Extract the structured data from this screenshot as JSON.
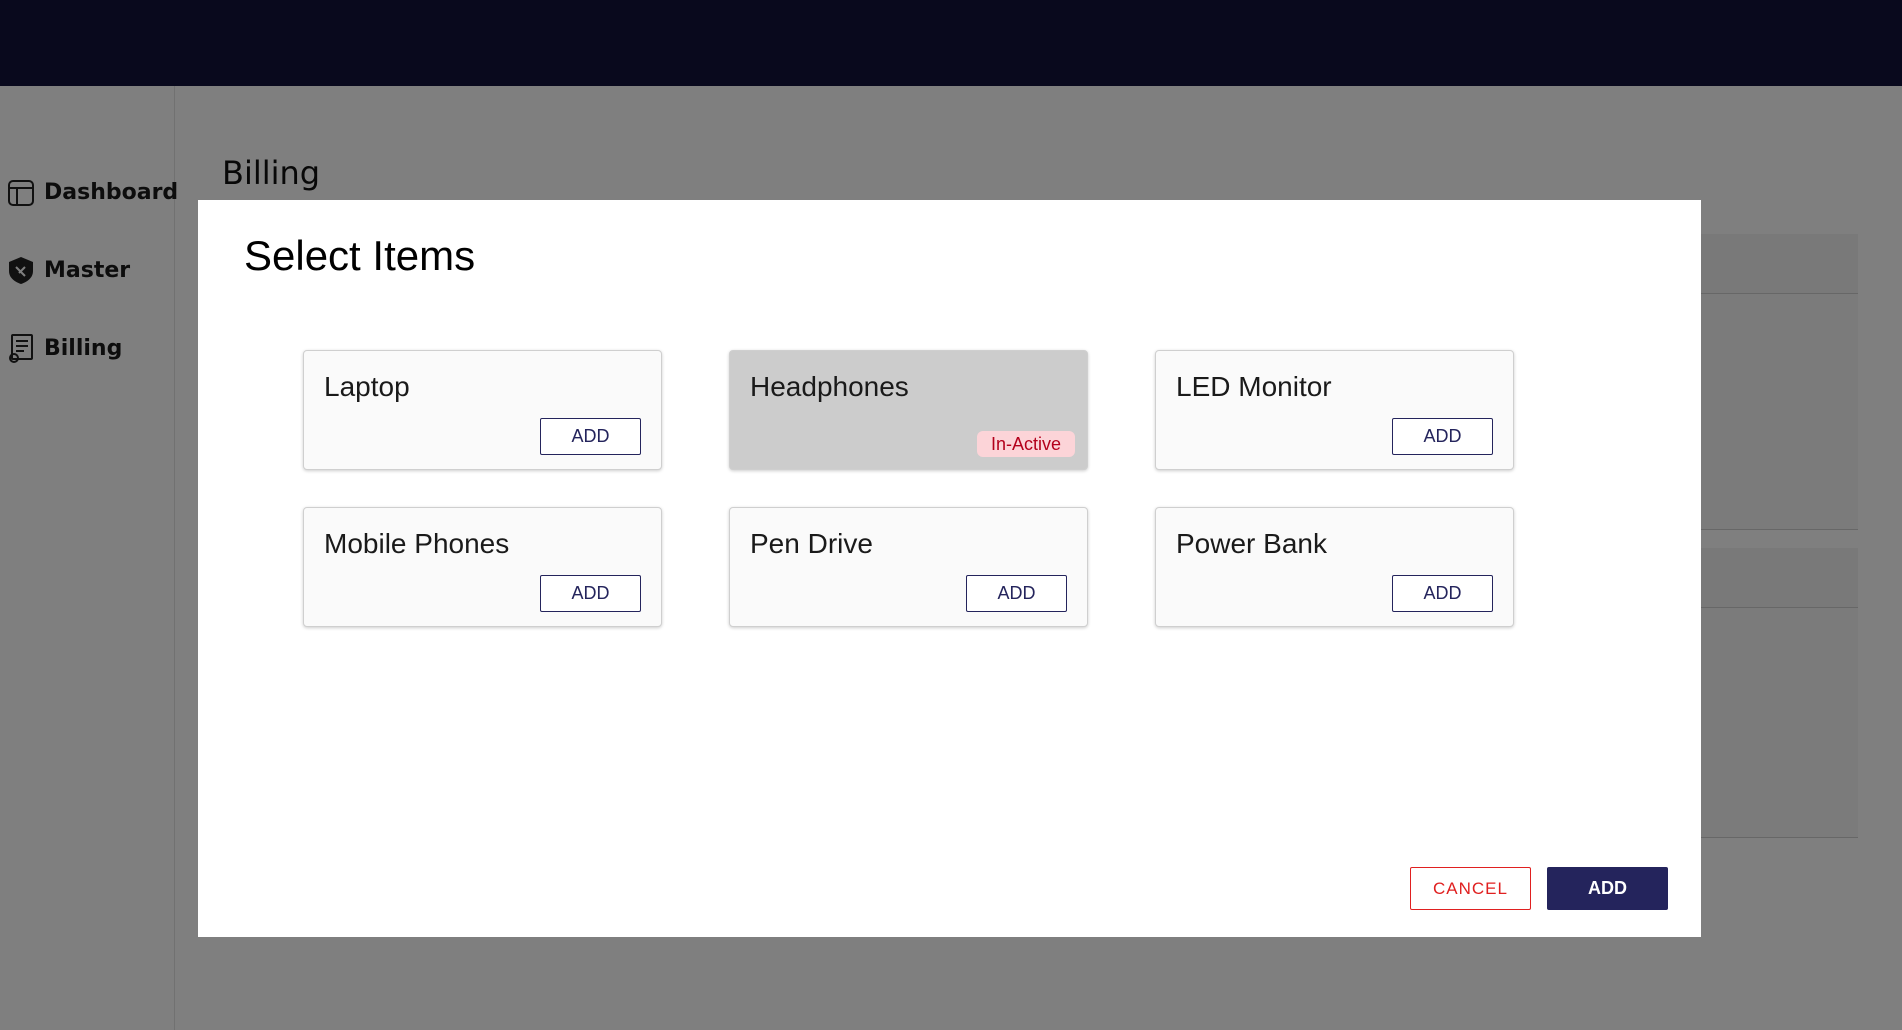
{
  "sidebar": {
    "items": [
      {
        "label": "Dashboard",
        "icon": "dashboard-icon"
      },
      {
        "label": "Master",
        "icon": "master-icon"
      },
      {
        "label": "Billing",
        "icon": "billing-icon"
      }
    ]
  },
  "page": {
    "title": "Billing"
  },
  "modal": {
    "title": "Select Items",
    "items": [
      {
        "name": "Laptop",
        "action": "ADD",
        "status": "active"
      },
      {
        "name": "Headphones",
        "status_label": "In-Active",
        "status": "inactive"
      },
      {
        "name": "LED Monitor",
        "action": "ADD",
        "status": "active"
      },
      {
        "name": "Mobile Phones",
        "action": "ADD",
        "status": "active"
      },
      {
        "name": "Pen Drive",
        "action": "ADD",
        "status": "active"
      },
      {
        "name": "Power Bank",
        "action": "ADD",
        "status": "active"
      }
    ],
    "cancel_label": "CANCEL",
    "add_label": "ADD"
  },
  "colors": {
    "topbar": "#13133b",
    "primary": "#24245c",
    "danger": "#e02020",
    "inactive_badge_bg": "#fcd4d8",
    "inactive_badge_text": "#b3001b"
  }
}
